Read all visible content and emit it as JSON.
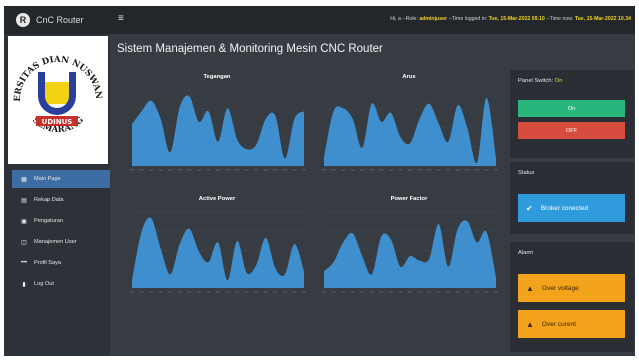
{
  "app": {
    "brand_initial": "R",
    "brand_name": "CnC Router",
    "menu_icon": "≡"
  },
  "header_info": {
    "prefix": "Hi, ",
    "user_short": "a",
    "role_label": " --Role: ",
    "role": "adminjuser",
    "login_label": " --Time logged in: ",
    "login_time": "Tue, 15-Mar-2022 09.10",
    "now_label": " --Time now: ",
    "now_time": "Tue, 15-Mar-2022 10.34"
  },
  "logo": {
    "top_arc": "UNIVERSITAS DIAN NUSWANTORO",
    "bottom_arc": "SEMARANG",
    "center": "UDINUS",
    "colors": {
      "blue": "#2a3f9b",
      "yellow": "#f3d216",
      "red": "#c9302c"
    }
  },
  "sidebar": {
    "items": [
      {
        "label": "Main Page",
        "icon": "dashboard-icon",
        "glyph": "▦",
        "active": true
      },
      {
        "label": "Rekap Data",
        "icon": "table-icon",
        "glyph": "▤",
        "active": false
      },
      {
        "label": "Pengaturan",
        "icon": "settings-icon",
        "glyph": "▣",
        "active": false
      },
      {
        "label": "Manajemen User",
        "icon": "users-icon",
        "glyph": "◫",
        "active": false
      },
      {
        "label": "Profil Saya",
        "icon": "dots-icon",
        "glyph": "•••",
        "active": false
      },
      {
        "label": "Log Out",
        "icon": "logout-icon",
        "glyph": "▮",
        "active": false
      }
    ]
  },
  "page_title": "Sistem Manajemen & Monitoring Mesin CNC Router",
  "charts": [
    {
      "title": "Tegangan",
      "fill": "#3f8fce"
    },
    {
      "title": "Arus",
      "fill": "#3f8fce"
    },
    {
      "title": "Active Power",
      "fill": "#3f8fce"
    },
    {
      "title": "Power Factor",
      "fill": "#3f8fce"
    }
  ],
  "chart_data": [
    {
      "type": "area",
      "title": "Tegangan",
      "values": [
        0.55,
        0.72,
        0.86,
        0.62,
        0.18,
        0.78,
        0.92,
        0.58,
        0.72,
        0.32,
        0.76,
        0.35,
        0.22,
        0.28,
        0.62,
        0.66,
        0.1,
        0.62,
        0.72
      ]
    },
    {
      "type": "area",
      "title": "Arus",
      "values": [
        0.12,
        0.72,
        0.76,
        0.62,
        0.24,
        0.82,
        0.58,
        0.7,
        0.38,
        0.3,
        0.62,
        0.82,
        0.56,
        0.32,
        0.8,
        0.5,
        0.04,
        0.9,
        0.1
      ]
    },
    {
      "type": "area",
      "title": "Active Power",
      "values": [
        0.1,
        0.74,
        0.92,
        0.52,
        0.18,
        0.58,
        0.78,
        0.48,
        0.34,
        0.6,
        0.1,
        0.62,
        0.2,
        0.3,
        0.66,
        0.26,
        0.18,
        0.58,
        0.22
      ]
    },
    {
      "type": "area",
      "title": "Power Factor",
      "values": [
        0.22,
        0.34,
        0.6,
        0.72,
        0.42,
        0.18,
        0.68,
        0.64,
        0.28,
        0.42,
        0.36,
        0.38,
        0.84,
        0.28,
        0.78,
        0.88,
        0.6,
        0.74,
        0.14
      ]
    }
  ],
  "panel_switch": {
    "label": "Panel Switch: ",
    "state": "On",
    "on_label": "On",
    "off_label": "OFF"
  },
  "status": {
    "heading": "Status",
    "message": "Broker conected",
    "icon": "check-icon"
  },
  "alarm": {
    "heading": "Alarm",
    "items": [
      {
        "label": "Over voltage",
        "icon": "warning-icon"
      },
      {
        "label": "Over curent",
        "icon": "warning-icon"
      }
    ]
  }
}
